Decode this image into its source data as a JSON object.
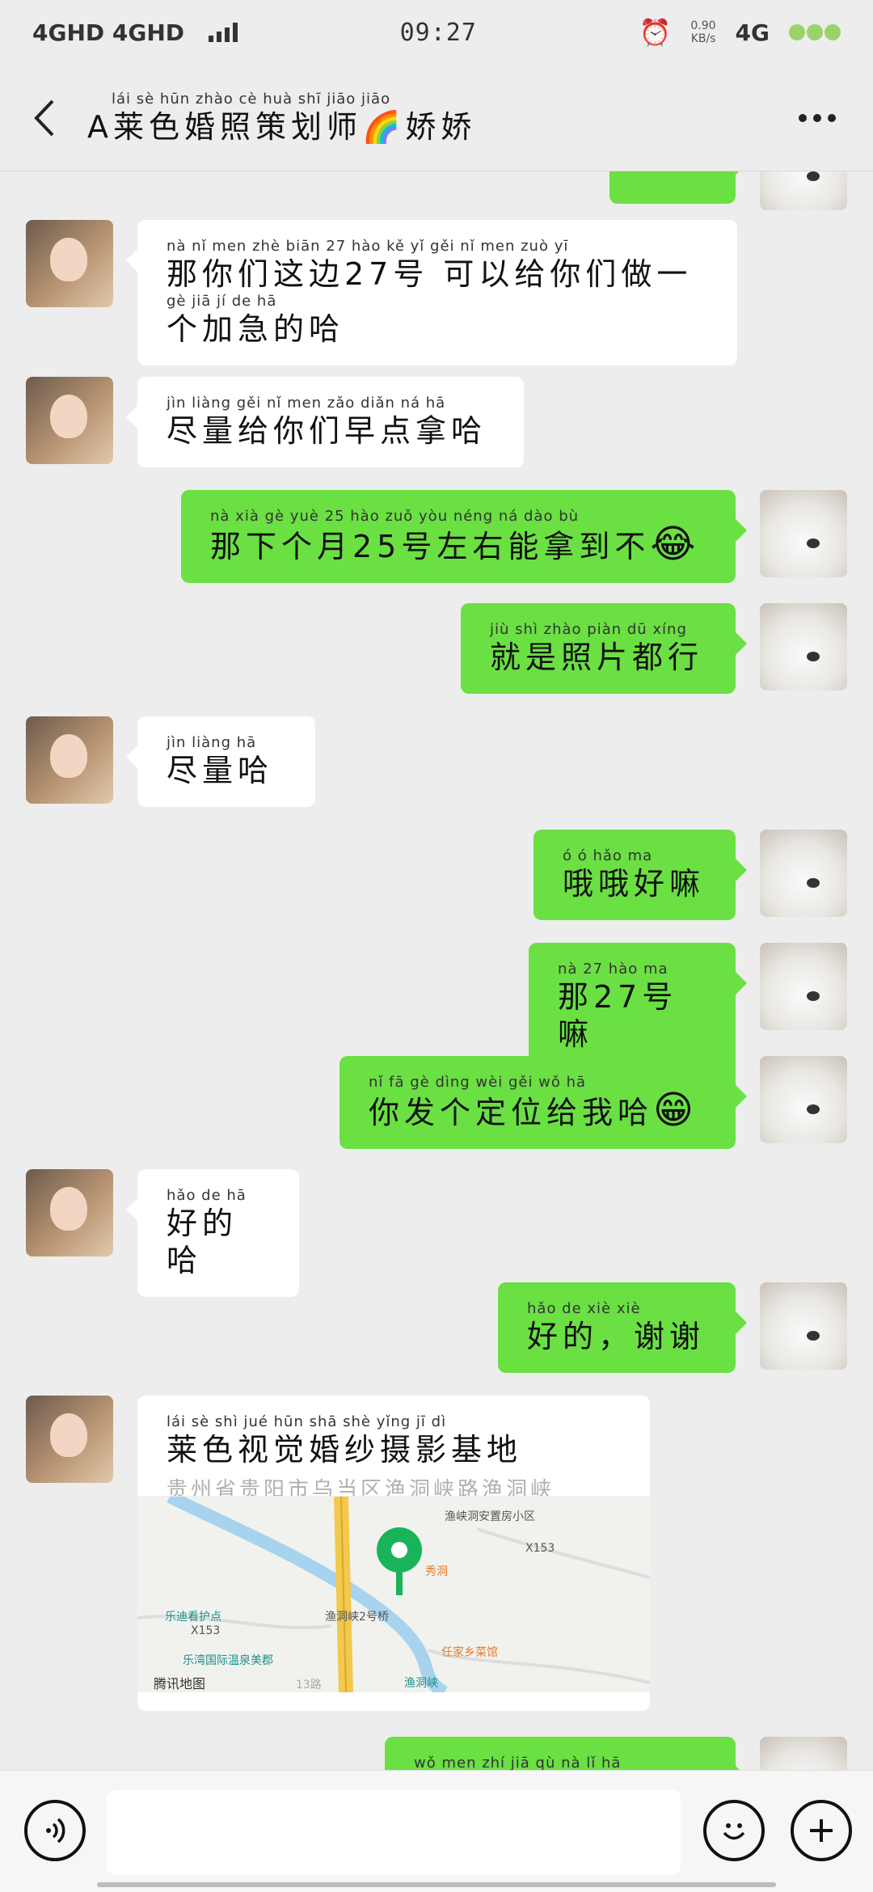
{
  "status": {
    "network_left": "4GHD 4GHD",
    "time": "09:27",
    "speed_value": "0.90",
    "speed_unit": "KB/s",
    "network_right": "4G"
  },
  "header": {
    "title": "A莱色婚照策划师🌈娇娇",
    "title_pinyin": "lái sè hūn zhào cè huà shī jiāo jiāo"
  },
  "messages": [
    {
      "side": "in",
      "pinyin": "nà nǐ men zhè biān 27 hào kě yǐ gěi nǐ men zuò yī",
      "text": "那你们这边27号 可以给你们做一",
      "pinyin2": "gè jiā jí de hā",
      "text2": "个加急的哈"
    },
    {
      "side": "in",
      "pinyin": "jìn liàng gěi nǐ men zǎo diǎn ná hā",
      "text": "尽量给你们早点拿哈"
    },
    {
      "side": "out",
      "pinyin": "nà xià gè yuè 25 hào zuǒ yòu néng ná dào bù",
      "text": "那下个月25号左右能拿到不",
      "emoji": "😂"
    },
    {
      "side": "out",
      "pinyin": "jiù shì zhào piàn dū xíng",
      "text": "就是照片都行"
    },
    {
      "side": "in",
      "pinyin": "jìn liàng hā",
      "text": "尽量哈"
    },
    {
      "side": "out",
      "pinyin": "ó ó hǎo ma",
      "text": "哦哦好嘛"
    },
    {
      "side": "out",
      "pinyin": "nà 27 hào ma",
      "text": "那27号嘛"
    },
    {
      "side": "out",
      "pinyin": "nǐ fā gè dìng wèi gěi wǒ hā",
      "text": "你发个定位给我哈",
      "emoji": "😁"
    },
    {
      "side": "in",
      "pinyin": "hǎo de hā",
      "text": "好的哈"
    },
    {
      "side": "out",
      "pinyin": "hǎo de xiè xiè",
      "text": "好的，谢谢"
    }
  ],
  "location": {
    "name_pinyin": "lái sè shì jué hūn shā shè yǐng jī dì",
    "name": "莱色视觉婚纱摄影基地",
    "address": "贵州省贵阳市乌当区渔洞峡路渔洞峡",
    "map_labels": {
      "community": "渔峡洞安置房小区",
      "x153a": "X153",
      "x153b": "X153",
      "xiudong": "秀洞",
      "bridge": "渔洞峡2号桥",
      "care": "乐迪看护点",
      "ledi": "乐湾国际温泉美郡",
      "hotel": "任家乡菜馆",
      "yudongxia": "渔洞峡",
      "brand": "腾讯地图",
      "road": "13路"
    }
  },
  "partial_message": {
    "pinyin": "wǒ men zhí jiā qù nà lǐ hā"
  }
}
